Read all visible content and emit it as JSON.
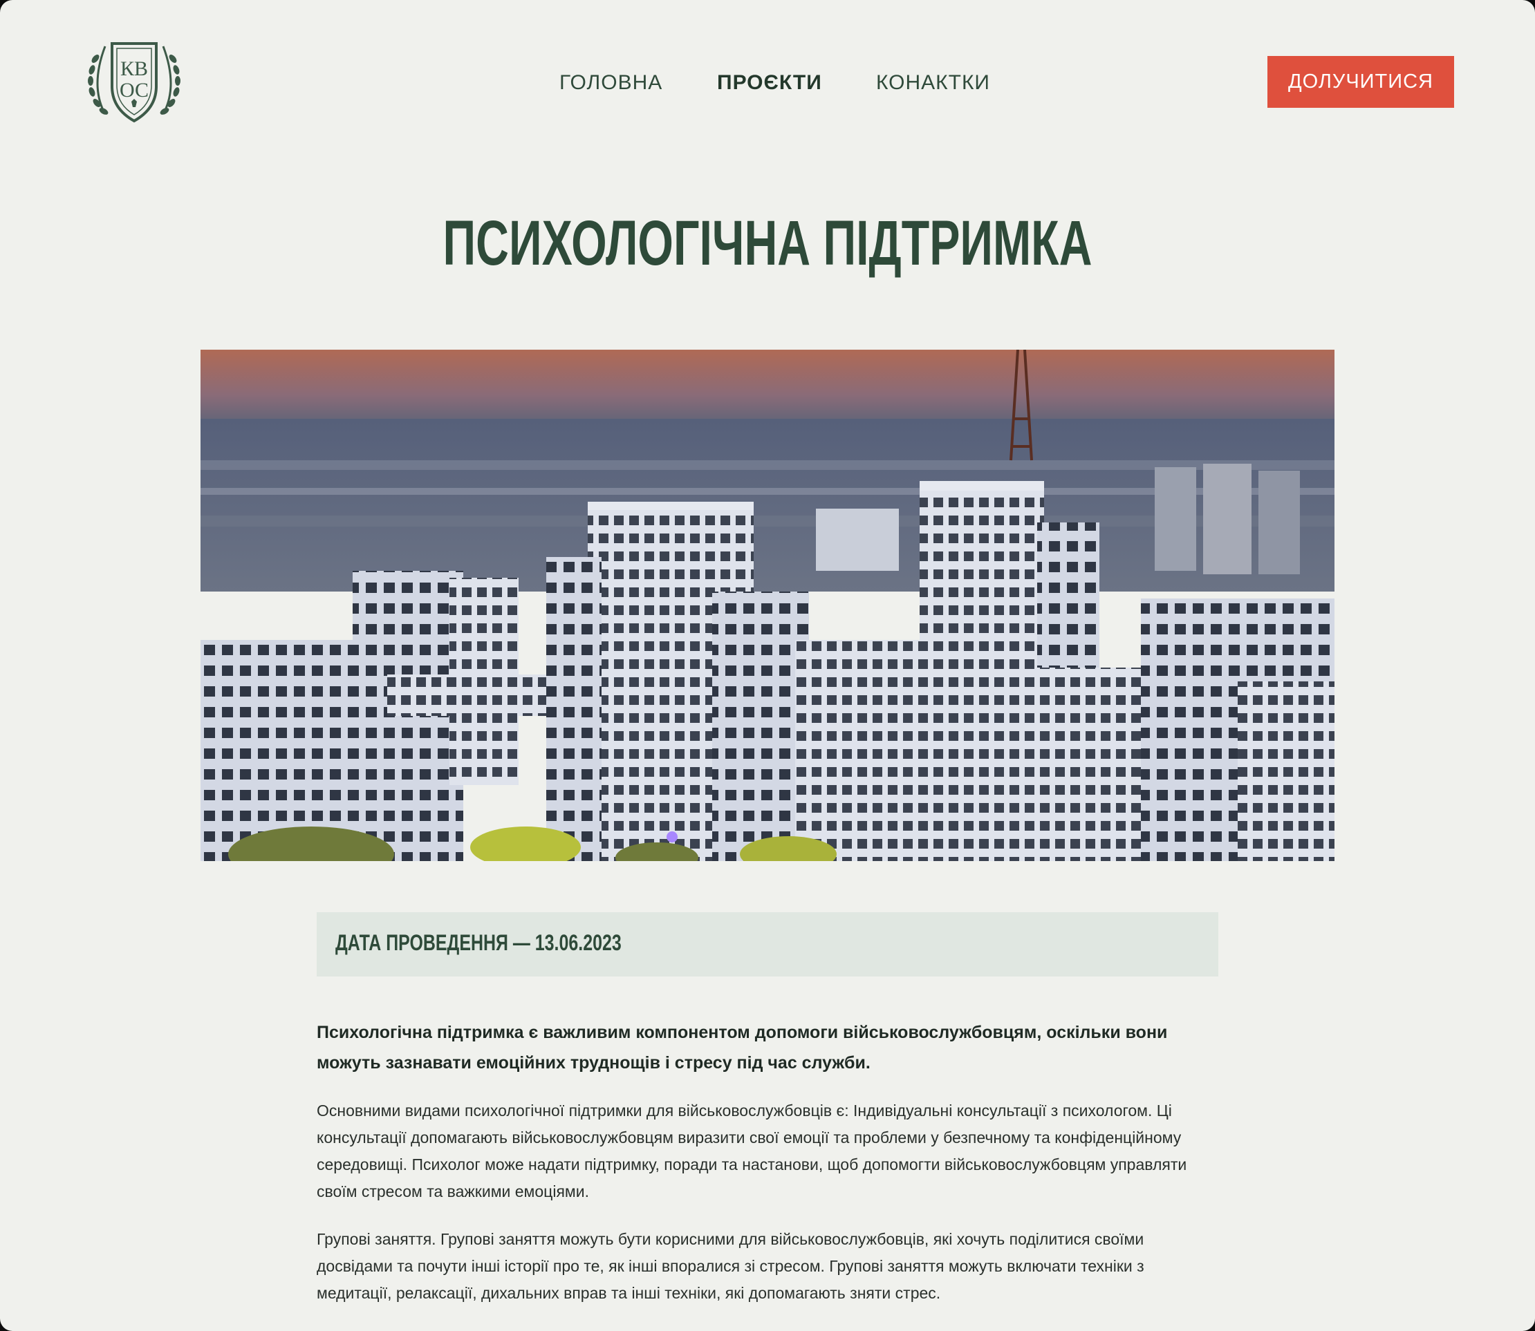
{
  "header": {
    "logo_text": [
      "КВ",
      "ОС"
    ],
    "nav": [
      {
        "label": "ГОЛОВНА",
        "active": false
      },
      {
        "label": "ПРОЄКТИ",
        "active": true
      },
      {
        "label": "КОНАКТКИ",
        "active": false
      }
    ],
    "cta_label": "ДОЛУЧИТИСЯ"
  },
  "colors": {
    "background": "#f0f1ed",
    "primary_green": "#2e4a39",
    "accent_red": "#df503d",
    "date_box_bg": "#e0e7e1"
  },
  "page": {
    "title": "ПСИХОЛОГІЧНА ПІДТРИМКА",
    "hero_image": "city-buildings-photo",
    "date_label": "ДАТА ПРОВЕДЕННЯ — 13.06.2023",
    "lead": "Психологічна підтримка є важливим компонентом допомоги військовослужбовцям, оскільки вони можуть зазнавати емоційних труднощів і стресу під час служби.",
    "paragraphs": [
      "Основними видами психологічної підтримки для військовослужбовців є: Індивідуальні консультації з психологом. Ці консультації допомагають військовослужбовцям виразити свої емоції та проблеми у безпечному та конфіденційному середовищі. Психолог може надати підтримку, поради та настанови, щоб допомогти військовослужбовцям управляти своїм стресом та важкими емоціями.",
      "Групові заняття. Групові заняття можуть бути корисними для військовослужбовців, які хочуть поділитися своїми досвідами та почути інші історії про те, як інші впоралися зі стресом. Групові заняття можуть включати техніки з медитації, релаксації, дихальних вправ та інші техніки, які допомагають зняти стрес."
    ]
  }
}
